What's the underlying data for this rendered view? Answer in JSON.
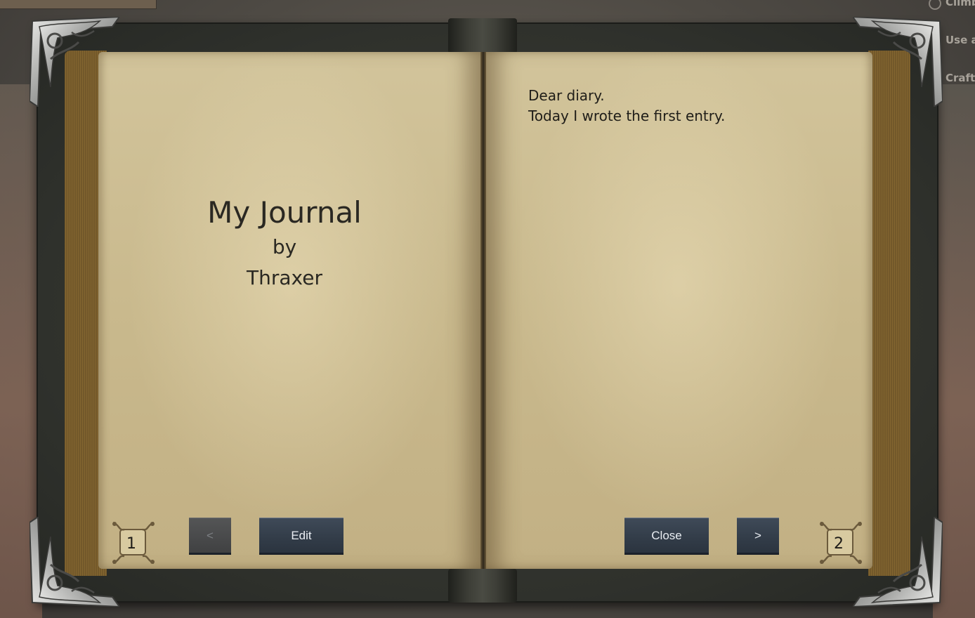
{
  "background_hints": {
    "hint_1": "Climb",
    "hint_2": "Use a",
    "hint_3": "Craft"
  },
  "book": {
    "left_page": {
      "title": "My Journal",
      "by": "by",
      "author": "Thraxer",
      "page_number": "1"
    },
    "right_page": {
      "lines": [
        "Dear diary.",
        "Today I wrote the first entry."
      ],
      "page_number": "2"
    }
  },
  "buttons": {
    "prev_label": "<",
    "edit_label": "Edit",
    "close_label": "Close",
    "next_label": ">"
  },
  "colors": {
    "button_bg": "#323c48",
    "button_disabled_bg": "#48494a",
    "page_paper": "#c9b98d",
    "cover": "#2f312c"
  },
  "icons": {
    "corner": "ornate-silver-corner-icon",
    "page_number_frame": "ornate-frame-icon"
  }
}
